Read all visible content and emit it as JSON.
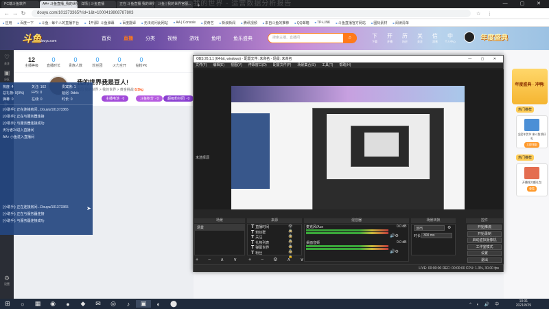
{
  "browser": {
    "tabs": [
      "PC端斗鱼软件",
      "AA+ 斗鱼直播_我的世界我...",
      "详情 | 斗鱼直播",
      "正在 斗鱼直播 我的世界...",
      "斗鱼 | 我的世界官服..."
    ],
    "title_overlay": "...我的世界 - 运营数据分析报告",
    "url": "douyu.com/101373365?rid=1&t=1000419808787803",
    "bookmarks": [
      "应用",
      "百度一下",
      "斗鱼 - 每个人的直播平台",
      "【开源】斗鱼弹幕",
      "百度翻译",
      "无法访问此网站",
      "AA | Console",
      "爱奇艺",
      "新浪新闻",
      "腾讯视频",
      "来自斗鱼的推荐",
      "QQ邮箱",
      "TP-LINK",
      "斗鱼直播官方网站",
      "图标素材",
      "阅读清单"
    ]
  },
  "header": {
    "logo_text": "斗鱼",
    "logo_sub": "douyu.com",
    "nav": [
      "首页",
      "直播",
      "分类",
      "视频",
      "游戏",
      "鱼吧",
      "鱼乐盛典"
    ],
    "active_nav": "直播",
    "search_placeholder": "搜索主播、直播间",
    "search_icon": "search-icon",
    "icons": [
      {
        "icon": "下",
        "label": "下载"
      },
      {
        "icon": "开",
        "label": "开播"
      },
      {
        "icon": "历",
        "label": "历史"
      },
      {
        "icon": "关",
        "label": "关注"
      },
      {
        "icon": "信",
        "label": "消息"
      },
      {
        "icon": "中",
        "label": "个人中心"
      }
    ],
    "promo": "年度盛典"
  },
  "sidebar": {
    "items": [
      {
        "icon": "♡",
        "label": "关注"
      },
      {
        "icon": "▣",
        "label": "分区"
      },
      {
        "icon": "♫",
        "label": "娱乐"
      },
      {
        "icon": "▶",
        "label": "视频"
      },
      {
        "icon": "☰",
        "label": "更多"
      }
    ],
    "bottom": {
      "icon": "⚙",
      "label": "设置"
    }
  },
  "stats": {
    "level": "12",
    "level_label": "主播等级",
    "items": [
      {
        "label": "直播时长",
        "value": "0"
      },
      {
        "label": "贵族人数",
        "value": "0"
      },
      {
        "label": "粉丝团",
        "value": "0"
      },
      {
        "label": "火力全开",
        "value": "0"
      },
      {
        "label": "钻粉PK",
        "value": "0"
      }
    ]
  },
  "room": {
    "title": "我的世界我是豆人!",
    "meta_prefix": "本周",
    "meta": "我的世界 > 我的世界 > 黄金挑战",
    "hot": "8.5kg",
    "tags": [
      "主播电池 · 0",
      "斗鱼积分 · 0",
      "超级粉丝团 · 0"
    ]
  },
  "overlay": {
    "stats": [
      "热度: 4",
      "关注: 162",
      "贵宾席: 1",
      "总礼物: 0(0%)",
      "FPS: 0",
      "延迟: 0kb/s",
      "弹幕: 0",
      "在线: 0",
      "时长: 0"
    ],
    "lines_top": [
      "[小助手]: 正在连接房间...Douyu/101373365",
      "[小助手]: 正在与服务器连接",
      "[小助手]: 与服务器连接成功",
      "天行者24进入直播间",
      "AA+ 小鱼进入直播间"
    ],
    "lines_bottom": [
      "[小助手]: 正在连接房间...Douyu/101373365",
      "[小助手]: 正在与服务器连接",
      "[小助手]: 与服务器连接成功"
    ]
  },
  "right_col": {
    "ad": "年度盛典 · 冲鸭!",
    "label1": "热门推荐",
    "card1": {
      "text": "全民年货节 来斗鱼领好礼",
      "btn": "立即领取"
    },
    "label2": "热门推荐",
    "card2": {
      "text": "开播领大额礼包",
      "btn": "查看"
    }
  },
  "obs": {
    "title": "OBS 26.1.1 (64-bit, windows) - 配置文件: 未命名 - 场景: 未命名",
    "menu": [
      "文件(F)",
      "编辑(E)",
      "视图(V)",
      "停靠窗口(D)",
      "配置文件(P)",
      "场景集合(S)",
      "工具(T)",
      "帮助(H)"
    ],
    "preview_label": "未选择源",
    "docks": {
      "scenes": "场景",
      "sources": "来源",
      "mixer": "混音器",
      "transitions": "场景转换",
      "controls": "控件"
    },
    "scene_item": "场景",
    "sources": [
      "直播时间",
      "粉丝群",
      "关注",
      "礼物列表",
      "弹幕世界",
      "粉丝"
    ],
    "mixer": [
      {
        "name": "麦克风/Aux",
        "db": "0.0 dB"
      },
      {
        "name": "桌面音频",
        "db": "0.0 dB"
      }
    ],
    "transition": {
      "label": "淡出",
      "duration_label": "时长",
      "duration": "300 ms"
    },
    "controls": [
      "开始推流",
      "开始录制",
      "启动虚拟摄像机",
      "工作室模式",
      "设置",
      "退出"
    ],
    "status": "LIVE: 00:00:00    REC: 00:00:00    CPU: 1.3%, 30.00 fps"
  },
  "taskbar": {
    "icons": [
      "⊞",
      "○",
      "▦",
      "◉",
      "●",
      "◆",
      "✉",
      "◎",
      "♪",
      "▣",
      "◐",
      "⬤"
    ],
    "active_index": 9,
    "time": "10:31",
    "date": "2021/8/29",
    "tray_icons": "^ ◐ 🔊 中"
  }
}
